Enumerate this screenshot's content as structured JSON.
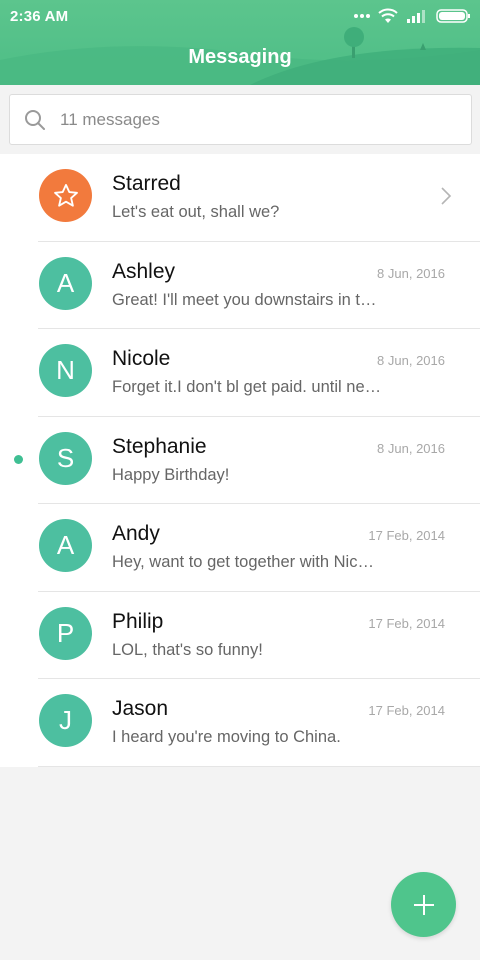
{
  "status_bar": {
    "time": "2:36 AM"
  },
  "header": {
    "title": "Messaging"
  },
  "search": {
    "placeholder": "11 messages"
  },
  "conversations": [
    {
      "initial": "",
      "name": "Starred",
      "preview": "Let's eat out, shall we?",
      "date": "",
      "starred": true,
      "unread": false
    },
    {
      "initial": "A",
      "name": "Ashley",
      "preview": "Great! I'll meet you downstairs in t…",
      "date": "8 Jun, 2016",
      "starred": false,
      "unread": false
    },
    {
      "initial": "N",
      "name": "Nicole",
      "preview": "Forget it.I don't bl get paid. until ne…",
      "date": "8 Jun, 2016",
      "starred": false,
      "unread": false
    },
    {
      "initial": "S",
      "name": "Stephanie",
      "preview": "Happy Birthday!",
      "date": "8 Jun, 2016",
      "starred": false,
      "unread": true
    },
    {
      "initial": "A",
      "name": "Andy",
      "preview": "Hey, want to get together with Nic…",
      "date": "17 Feb, 2014",
      "starred": false,
      "unread": false
    },
    {
      "initial": "P",
      "name": "Philip",
      "preview": "LOL, that's so funny!",
      "date": "17 Feb, 2014",
      "starred": false,
      "unread": false
    },
    {
      "initial": "J",
      "name": "Jason",
      "preview": "I heard you're moving to China.",
      "date": "17 Feb, 2014",
      "starred": false,
      "unread": false
    }
  ],
  "fab": {
    "icon": "plus-icon"
  },
  "colors": {
    "header": "#5cc58d",
    "avatar": "#4dbfa0",
    "starred_avatar": "#f27a3d",
    "fab": "#4fc58c",
    "unread_dot": "#3fbf93"
  }
}
